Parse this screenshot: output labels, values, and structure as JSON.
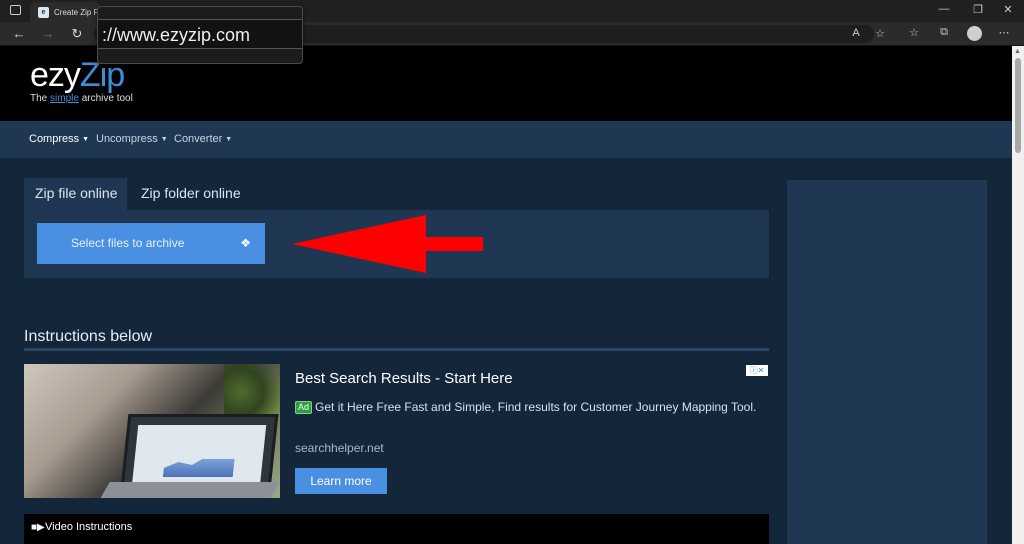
{
  "browser": {
    "tab_title": "Create Zip F",
    "favicon": "e",
    "url": "://www.ezyzip.com",
    "controls": {
      "minimize": "—",
      "maximize": "❐",
      "close": "✕"
    }
  },
  "site": {
    "logo_ezy": "ezy",
    "logo_zip": "Zip",
    "tagline_prefix": "The ",
    "tagline_simple": "simple",
    "tagline_suffix": " archive tool"
  },
  "nav": {
    "items": [
      {
        "label": "Compress"
      },
      {
        "label": "Uncompress"
      },
      {
        "label": "Converter"
      }
    ]
  },
  "main": {
    "tabs": [
      {
        "label": "Zip file online"
      },
      {
        "label": "Zip folder online"
      }
    ],
    "select_button": "Select files to archive",
    "instructions_title": "Instructions below"
  },
  "ad": {
    "title": "Best Search Results - Start Here",
    "badge": "Ad",
    "description": "Get it Here Free Fast and Simple, Find results for Customer Journey Mapping Tool.",
    "domain": "searchhelper.net",
    "cta": "Learn more",
    "adchoices": "ⓘ✕"
  },
  "video": {
    "label": "Video Instructions"
  },
  "colors": {
    "accent": "#4a90e2",
    "arrow": "#ff0000",
    "page_bg": "#13263a",
    "panel_bg": "#1f3752"
  }
}
